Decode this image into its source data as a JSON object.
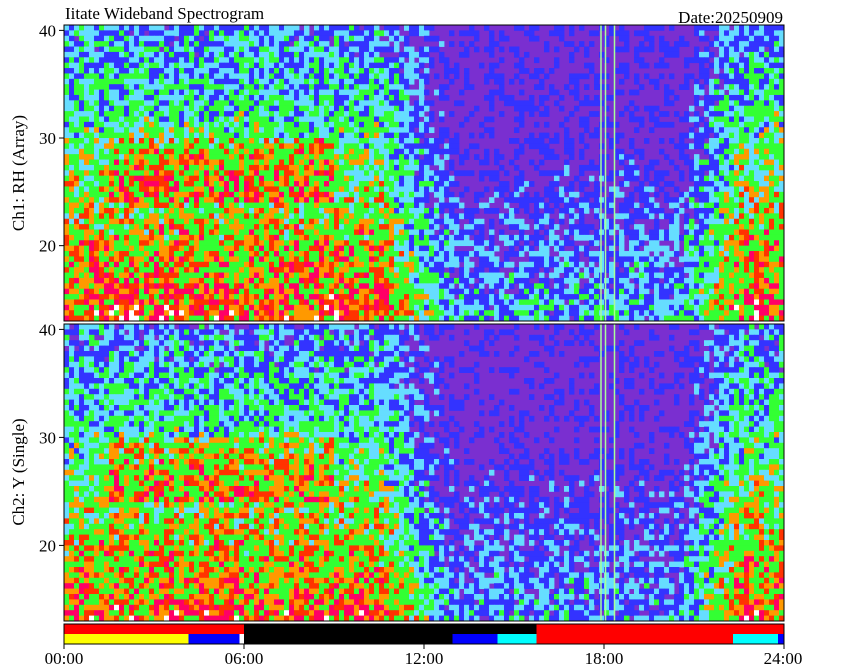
{
  "chart_data": {
    "type": "heatmap",
    "title": "Iitate Wideband Spectrogram",
    "date_label": "Date:20250909",
    "x_tick_labels": [
      "00:00",
      "06:00",
      "12:00",
      "18:00",
      "24:00"
    ],
    "x_range_hours": [
      0,
      24
    ],
    "panels": [
      {
        "ylabel": "Ch1: RH (Array)",
        "y_tick_labels": [
          "20",
          "30",
          "40"
        ],
        "y_ticks": [
          20,
          30,
          40
        ],
        "ylim": [
          13,
          40.5
        ]
      },
      {
        "ylabel": "Ch2: Y (Single)",
        "y_tick_labels": [
          "20",
          "30",
          "40"
        ],
        "y_ticks": [
          20,
          30,
          40
        ],
        "ylim": [
          13,
          40.5
        ]
      }
    ],
    "status_bar": {
      "top_row": [
        {
          "start_h": 0,
          "end_h": 24,
          "color": "#ff0000"
        }
      ],
      "bottom_row": [
        {
          "start_h": 0,
          "end_h": 4.15,
          "color": "#ffff00"
        },
        {
          "start_h": 4.15,
          "end_h": 5.85,
          "color": "#0000ff"
        },
        {
          "start_h": 5.85,
          "end_h": 6.0,
          "color": "#ffffff"
        },
        {
          "start_h": 6.0,
          "end_h": 12.95,
          "color": "#000000"
        },
        {
          "start_h": 12.95,
          "end_h": 14.45,
          "color": "#0000ff"
        },
        {
          "start_h": 14.45,
          "end_h": 15.75,
          "color": "#00ffff"
        },
        {
          "start_h": 15.75,
          "end_h": 22.3,
          "color": "#ff0000"
        },
        {
          "start_h": 22.3,
          "end_h": 23.8,
          "color": "#00ffff"
        },
        {
          "start_h": 23.8,
          "end_h": 24,
          "color": "#0000ff"
        }
      ],
      "top_row_black": {
        "start_h": 6.0,
        "end_h": 15.75,
        "color": "#000000"
      }
    },
    "colormap": [
      "#ffffff",
      "#ff0066",
      "#ff3300",
      "#ff9900",
      "#33ff33",
      "#66ddff",
      "#3333ff",
      "#6600cc"
    ]
  }
}
